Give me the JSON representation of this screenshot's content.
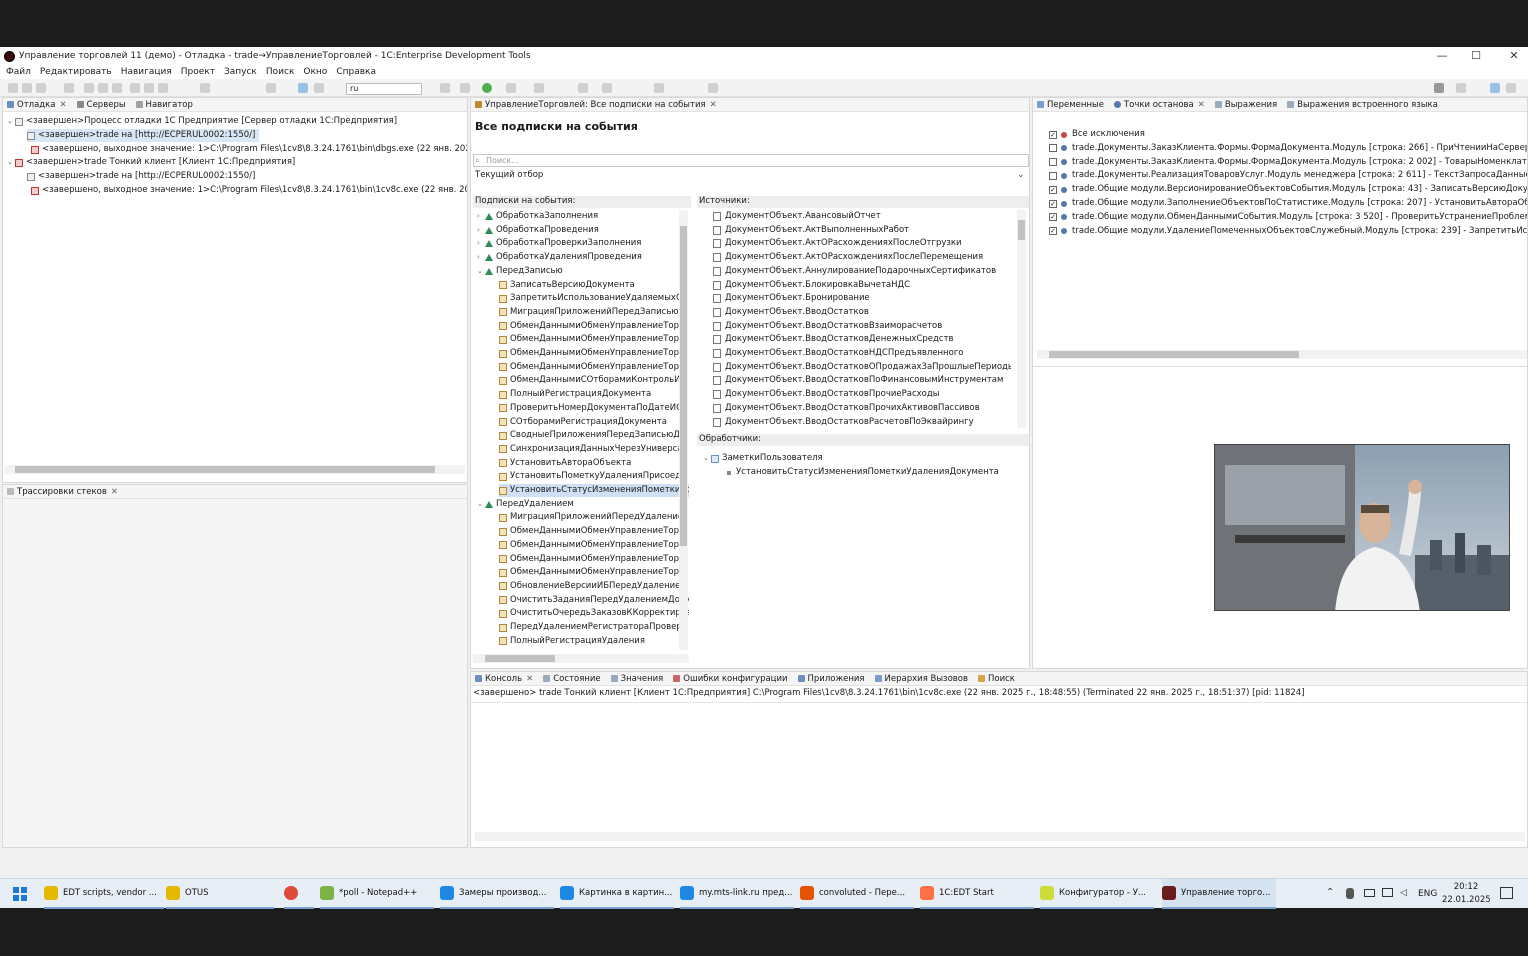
{
  "window": {
    "title": "Управление торговлей 11 (демо) - Отладка - trade→УправлениеТорговлей - 1C:Enterprise Development Tools",
    "controls": [
      "—",
      "☐",
      "✕"
    ]
  },
  "menu": [
    "Файл",
    "Редактировать",
    "Навигация",
    "Проект",
    "Запуск",
    "Поиск",
    "Окно",
    "Справка"
  ],
  "toolbar": {
    "lang_combo": "ru"
  },
  "debug_panel": {
    "tabs": [
      "Отладка",
      "Серверы",
      "Навигатор"
    ],
    "rows": [
      "<завершен>Процесс отладки 1С Предприятие [Сервер отладки 1С:Предприятия]",
      "<завершен>trade на [http://ECPERUL0002:1550/]",
      "<завершено, выходное значение: 1>C:\\Program Files\\1cv8\\8.3.24.1761\\bin\\dbgs.exe (22 янв. 2025 г., 18:4",
      "<завершен>trade Тонкий клиент [Клиент 1С:Предприятия]",
      "<завершен>trade на [http://ECPERUL0002:1550/]",
      "<завершено, выходное значение: 1>C:\\Program Files\\1cv8\\8.3.24.1761\\bin\\1cv8c.exe (22 янв. 2025 г., 18:4"
    ]
  },
  "stack_panel": {
    "tab": "Трассировки стеков"
  },
  "subs_panel": {
    "tab": "УправлениеТорговлей: Все подписки на события",
    "heading": "Все подписки на события",
    "search_placeholder": "Поиск...",
    "filter_label": "Текущий отбор",
    "left_header": "Подписки на события:",
    "right_header": "Источники:",
    "handlers_header": "Обработчики:",
    "subscriptions": [
      {
        "label": "ОбработкаЗаполнения",
        "kind": "group"
      },
      {
        "label": "ОбработкаПроведения",
        "kind": "group"
      },
      {
        "label": "ОбработкаПроверкиЗаполнения",
        "kind": "group"
      },
      {
        "label": "ОбработкаУдаленияПроведения",
        "kind": "group"
      },
      {
        "label": "ПередЗаписью",
        "kind": "group-open"
      },
      {
        "label": "ЗаписатьВерсиюДокумента",
        "kind": "item"
      },
      {
        "label": "ЗапретитьИспользованиеУдаляемыхОб",
        "kind": "item"
      },
      {
        "label": "МиграцияПриложенийПередЗаписьюД",
        "kind": "item"
      },
      {
        "label": "ОбменДаннымиОбменУправлениеТор",
        "kind": "item"
      },
      {
        "label": "ОбменДаннымиОбменУправлениеТор",
        "kind": "item"
      },
      {
        "label": "ОбменДаннымиОбменУправлениеТор",
        "kind": "item"
      },
      {
        "label": "ОбменДаннымиОбменУправлениеТор",
        "kind": "item"
      },
      {
        "label": "ОбменДаннымиСОтборамиКонтрольИ",
        "kind": "item"
      },
      {
        "label": "ПолныйРегистрацияДокумента",
        "kind": "item"
      },
      {
        "label": "ПроверитьНомерДокументаПоДатеИО",
        "kind": "item"
      },
      {
        "label": "СОтборамиРегистрацияДокумента",
        "kind": "item"
      },
      {
        "label": "СводныеПриложенияПередЗаписьюДо",
        "kind": "item"
      },
      {
        "label": "СинхронизацияДанныхЧерезУниверса",
        "kind": "item"
      },
      {
        "label": "УстановитьАвтораОбъекта",
        "kind": "item"
      },
      {
        "label": "УстановитьПометкуУдаленияПрисоеди",
        "kind": "item"
      },
      {
        "label": "УстановитьСтатусИзмененияПометкиУд",
        "kind": "item-selected"
      },
      {
        "label": "ПередУдалением",
        "kind": "group-open"
      },
      {
        "label": "МиграцияПриложенийПередУдаление",
        "kind": "item"
      },
      {
        "label": "ОбменДаннымиОбменУправлениеТор",
        "kind": "item"
      },
      {
        "label": "ОбменДаннымиОбменУправлениеТор",
        "kind": "item"
      },
      {
        "label": "ОбменДаннымиОбменУправлениеТор",
        "kind": "item"
      },
      {
        "label": "ОбменДаннымиОбменУправлениеТор",
        "kind": "item"
      },
      {
        "label": "ОбновлениеВерсииИБПередУдаление",
        "kind": "item"
      },
      {
        "label": "ОчиститьЗаданияПередУдалениемДоку",
        "kind": "item"
      },
      {
        "label": "ОчиститьОчередьЗаказовККорректиров",
        "kind": "item"
      },
      {
        "label": "ПередУдалениемРегистратораПроверк",
        "kind": "item"
      },
      {
        "label": "ПолныйРегистрацияУдаления",
        "kind": "item"
      }
    ],
    "sources": [
      "ДокументОбъект.АвансовыйОтчет",
      "ДокументОбъект.АктВыполненныхРабот",
      "ДокументОбъект.АктОРасхожденияхПослеОтгрузки",
      "ДокументОбъект.АктОРасхожденияхПослеПеремещения",
      "ДокументОбъект.АннулированиеПодарочныхСертификатов",
      "ДокументОбъект.БлокировкаВычетаНДС",
      "ДокументОбъект.Бронирование",
      "ДокументОбъект.ВводОстатков",
      "ДокументОбъект.ВводОстатковВзаиморасчетов",
      "ДокументОбъект.ВводОстатковДенежныхСредств",
      "ДокументОбъект.ВводОстатковНДСПредъявленного",
      "ДокументОбъект.ВводОстатковОПродажахЗаПрошлыеПериоды",
      "ДокументОбъект.ВводОстатковПоФинансовымИнструментам",
      "ДокументОбъект.ВводОстатковПрочиеРасходы",
      "ДокументОбъект.ВводОстатковПрочихАктивовПассивов",
      "ДокументОбъект.ВводОстатковРасчетовПоЭквайрингу"
    ],
    "handlers": [
      {
        "label": "ЗаметкиПользователя",
        "level": 0
      },
      {
        "label": "УстановитьСтатусИзмененияПометкиУдаленияДокумента",
        "level": 1
      }
    ]
  },
  "breakpoints_panel": {
    "tabs": [
      "Переменные",
      "Точки останова",
      "Выражения",
      "Выражения встроенного языка"
    ],
    "rows": [
      {
        "checked": true,
        "text": "Все исключения"
      },
      {
        "checked": false,
        "text": "trade.Документы.ЗаказКлиента.Формы.ФормаДокумента.Модуль [строка: 266] - ПриЧтенииНаСервере(Текущ"
      },
      {
        "checked": false,
        "text": "trade.Документы.ЗаказКлиента.Формы.ФормаДокумента.Модуль [строка: 2 002] - ТоварыНоменклатураПриИ"
      },
      {
        "checked": false,
        "text": "trade.Документы.РеализацияТоваровУслуг.Модуль менеджера [строка: 2 611] - ТекстЗапросаДанныеДокуме"
      },
      {
        "checked": true,
        "text": "trade.Общие модули.ВерсионированиеОбъектовСобытия.Модуль [строка: 43] - ЗаписатьВерсиюДокумента(Ис"
      },
      {
        "checked": true,
        "text": "trade.Общие модули.ЗаполнениеОбъектовПоСтатистике.Модуль [строка: 207] - УстановитьАвтораОбъекта"
      },
      {
        "checked": true,
        "text": "trade.Общие модули.ОбменДаннымиСобытия.Модуль [строка: 3 520] - ПроверитьУстранениеПроблемыДок"
      },
      {
        "checked": true,
        "text": "trade.Общие модули.УдалениеПомеченныхОбъектовСлужебный.Модуль [строка: 239] - ЗапретитьИспользо"
      }
    ]
  },
  "console": {
    "tabs": [
      "Консоль",
      "Состояние",
      "Значения",
      "Ошибки конфигурации",
      "Приложения",
      "Иерархия Вызовов",
      "Поиск"
    ],
    "line": "<завершено> trade Тонкий клиент [Клиент 1С:Предприятия] C:\\Program Files\\1cv8\\8.3.24.1761\\bin\\1cv8c.exe (22 янв. 2025 г., 18:48:55) (Terminated 22 янв. 2025 г., 18:51:37) [pid: 11824]"
  },
  "taskbar": {
    "items": [
      {
        "label": "EDT scripts, vendor ...",
        "color": "#e6b800"
      },
      {
        "label": "OTUS",
        "color": "#e6b800"
      },
      {
        "label": "",
        "color": "#dd4b39"
      },
      {
        "label": "*poll - Notepad++",
        "color": "#7cb342"
      },
      {
        "label": "Замеры производ...",
        "color": "#1e88e5"
      },
      {
        "label": "Картинка в картин...",
        "color": "#1e88e5"
      },
      {
        "label": "my.mts-link.ru пред...",
        "color": "#1e88e5"
      },
      {
        "label": "convoluted - Пере...",
        "color": "#e65100"
      },
      {
        "label": "1C:EDT Start",
        "color": "#ff7043"
      },
      {
        "label": "Конфигуратор - У...",
        "color": "#cddc39"
      },
      {
        "label": "Управление торго...",
        "color": "#6a1b1b"
      }
    ],
    "lang": "ENG",
    "time": "20:12",
    "date": "22.01.2025"
  }
}
